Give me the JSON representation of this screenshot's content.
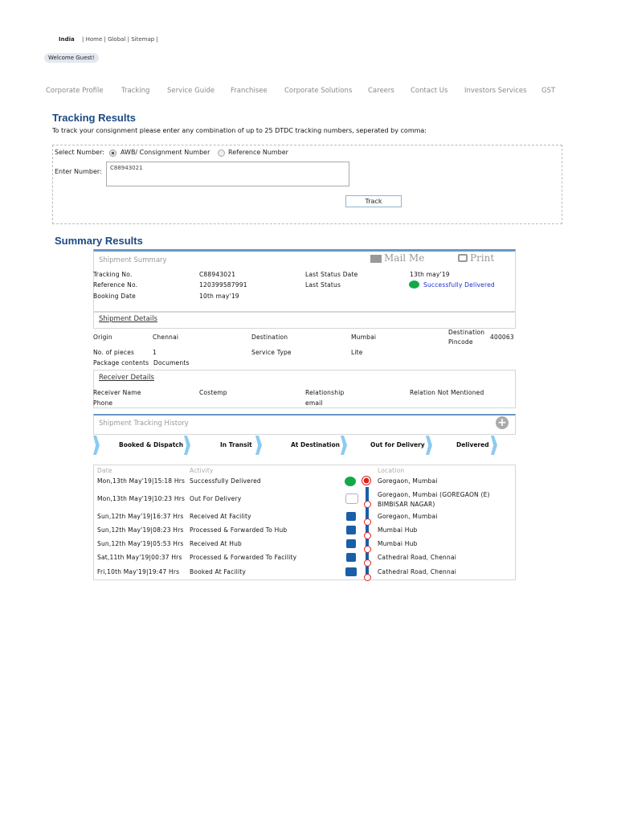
{
  "top": {
    "country": "India",
    "links": "| Home | Global | Sitemap |",
    "welcome": "Welcome Guest!"
  },
  "nav": [
    "Corporate Profile",
    "Tracking",
    "Service Guide",
    "Franchisee",
    "Corporate Solutions",
    "Careers",
    "Contact Us",
    "Investors Services",
    "GST"
  ],
  "tracking": {
    "title": "Tracking Results",
    "instruction": "To track your consignment please enter any combination of up to 25 DTDC tracking numbers, seperated by comma:",
    "select_label": "Select Number:",
    "option_awb": "AWB/ Consignment Number",
    "option_ref": "Reference Number",
    "enter_label": "Enter Number:",
    "number_value": "C88943021",
    "track_button": "Track"
  },
  "summary": {
    "title": "Summary Results",
    "header": "Shipment Summary",
    "mail": "Mail Me",
    "print": "Print",
    "tracking_label": "Tracking No.",
    "tracking_value": "C88943021",
    "reference_label": "Reference No.",
    "reference_value": "120399587991",
    "booking_label": "Booking Date",
    "booking_value": "10th may'19",
    "last_date_label": "Last Status Date",
    "last_date_value": "13th may'19",
    "last_status_label": "Last Status",
    "last_status_value": "Successfully Delivered"
  },
  "details": {
    "header": "Shipment Details",
    "origin_label": "Origin",
    "origin_value": "Chennai",
    "dest_label": "Destination",
    "dest_value": "Mumbai",
    "pincode_label": "Destination Pincode",
    "pincode_value": "400063",
    "pieces_label": "No. of pieces",
    "pieces_value": "1",
    "service_label": "Service Type",
    "service_value": "Lite",
    "contents_label": "Package contents",
    "contents_value": "Documents"
  },
  "receiver": {
    "header": "Receiver Details",
    "name_label": "Receiver Name",
    "name_value": "Costemp",
    "rel_label": "Relationship",
    "rel_value": "Relation Not Mentioned",
    "phone_label": "Phone",
    "email_label": "email"
  },
  "history": {
    "header": "Shipment Tracking History",
    "steps": [
      "Booked & Dispatch",
      "In Transit",
      "At Destination",
      "Out for Delivery",
      "Delivered"
    ],
    "col_date": "Date",
    "col_activity": "Activity",
    "col_location": "Location",
    "rows": [
      {
        "date": "Mon,13th May'19|15:18 Hrs",
        "activity": "Successfully Delivered",
        "location": "Goregaon, Mumbai"
      },
      {
        "date": "Mon,13th May'19|10:23 Hrs",
        "activity": "Out For Delivery",
        "location": "Goregaon, Mumbai (GOREGAON (E) BIMBISAR NAGAR)"
      },
      {
        "date": "Sun,12th May'19|16:37 Hrs",
        "activity": "Received At Facility",
        "location": "Goregaon, Mumbai"
      },
      {
        "date": "Sun,12th May'19|08:23 Hrs",
        "activity": "Processed & Forwarded To Hub",
        "location": "Mumbai Hub"
      },
      {
        "date": "Sun,12th May'19|05:53 Hrs",
        "activity": "Received At Hub",
        "location": "Mumbai Hub"
      },
      {
        "date": "Sat,11th May'19|00:37 Hrs",
        "activity": "Processed & Forwarded To Facility",
        "location": "Cathedral Road, Chennai"
      },
      {
        "date": "Fri,10th May'19|19:47 Hrs",
        "activity": "Booked At Facility",
        "location": "Cathedral Road, Chennai"
      }
    ]
  },
  "colors": {
    "brand": "#1a4a82",
    "delivered": "#14a84a",
    "timeline": "#1a5ea8"
  }
}
